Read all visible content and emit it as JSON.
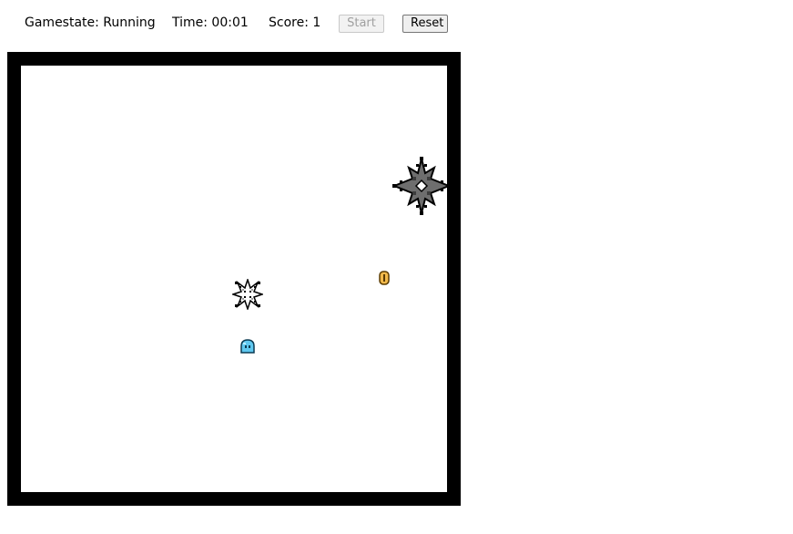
{
  "hud": {
    "gamestate_text": "Gamestate: Running",
    "time_text": "Time: 00:01",
    "score_text": "Score: 1",
    "start_label": "Start",
    "reset_label": "Reset",
    "start_disabled": true
  },
  "game": {
    "state": "Running",
    "time": "00:01",
    "score": 1,
    "border_color": "#000000",
    "field_color": "#ffffff",
    "entities": [
      {
        "type": "spike-star",
        "size": "large",
        "color": "#6e6e6e"
      },
      {
        "type": "spike-star",
        "size": "small",
        "color": "#ffffff"
      },
      {
        "type": "coin",
        "color": "#f2b94b"
      },
      {
        "type": "player-slime",
        "color": "#5fc8f0"
      }
    ]
  }
}
